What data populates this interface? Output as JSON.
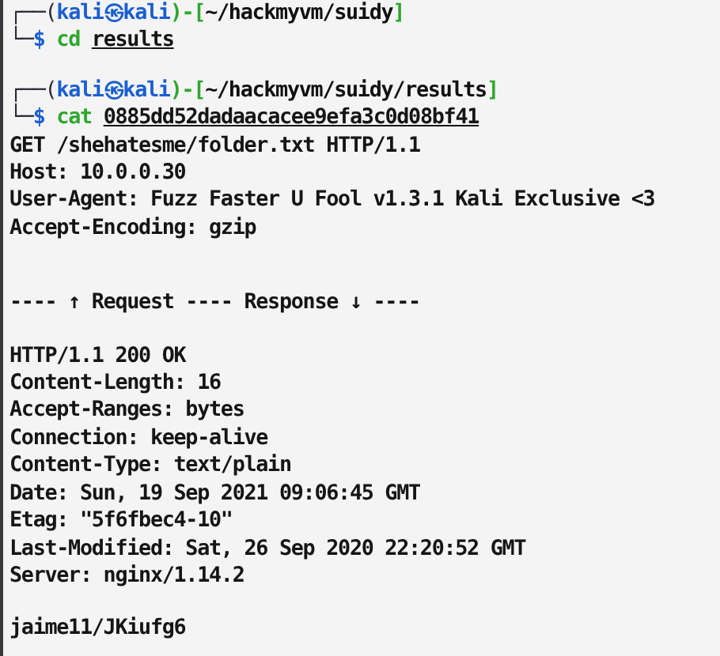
{
  "terminal": {
    "entries": [
      {
        "kind": "prompt",
        "frame_open": "┌──(",
        "user": "kali",
        "separator": "㉿",
        "host": "kali",
        "frame_mid": ")-[",
        "path": "~/hackmyvm/suidy",
        "frame_close": "]",
        "corner": "└─",
        "symbol": "$",
        "command": "cd",
        "argument": "results"
      },
      {
        "kind": "prompt",
        "frame_open": "┌──(",
        "user": "kali",
        "separator": "㉿",
        "host": "kali",
        "frame_mid": ")-[",
        "path": "~/hackmyvm/suidy/results",
        "frame_close": "]",
        "corner": "└─",
        "symbol": "$",
        "command": "cat",
        "argument": "0885dd52dadaacacee9efa3c0d08bf41"
      },
      {
        "kind": "request",
        "lines": [
          "GET /shehatesme/folder.txt HTTP/1.1",
          "Host: 10.0.0.30",
          "User-Agent: Fuzz Faster U Fool v1.3.1 Kali Exclusive <3",
          "Accept-Encoding: gzip"
        ]
      },
      {
        "kind": "separator",
        "lines": [
          "---- ↑ Request ---- Response ↓ ----"
        ]
      },
      {
        "kind": "response",
        "lines": [
          "HTTP/1.1 200 OK",
          "Content-Length: 16",
          "Accept-Ranges: bytes",
          "Connection: keep-alive",
          "Content-Type: text/plain",
          "Date: Sun, 19 Sep 2021 09:06:45 GMT",
          "Etag: \"5f6fbec4-10\"",
          "Last-Modified: Sat, 26 Sep 2020 22:20:52 GMT",
          "Server: nginx/1.14.2"
        ]
      },
      {
        "kind": "body",
        "lines": [
          "jaime11/JKiufg6"
        ]
      }
    ]
  }
}
